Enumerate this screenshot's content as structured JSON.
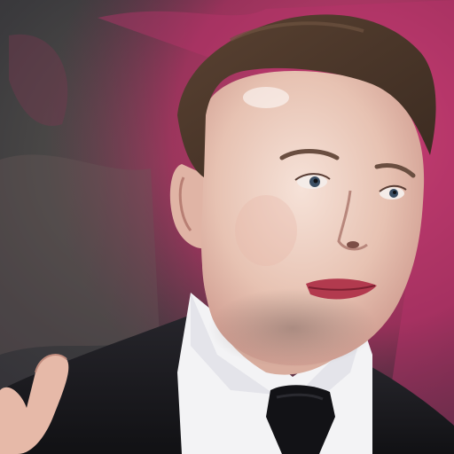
{
  "image": {
    "kind": "photo",
    "subject": "portrait-of-man-in-suit",
    "colors": {
      "bg_dark": "#2e2b30",
      "bg_green": "#4d5a52",
      "bg_magenta": "#b3306a",
      "bg_pink": "#c8446f",
      "skin_light": "#f0d8cc",
      "skin_mid": "#e2bba9",
      "skin_shadow": "#c9968a",
      "hair": "#4a3628",
      "suit": "#1b1b20",
      "shirt": "#f3f3f5",
      "tie": "#111114",
      "lips": "#b23a4e"
    }
  }
}
